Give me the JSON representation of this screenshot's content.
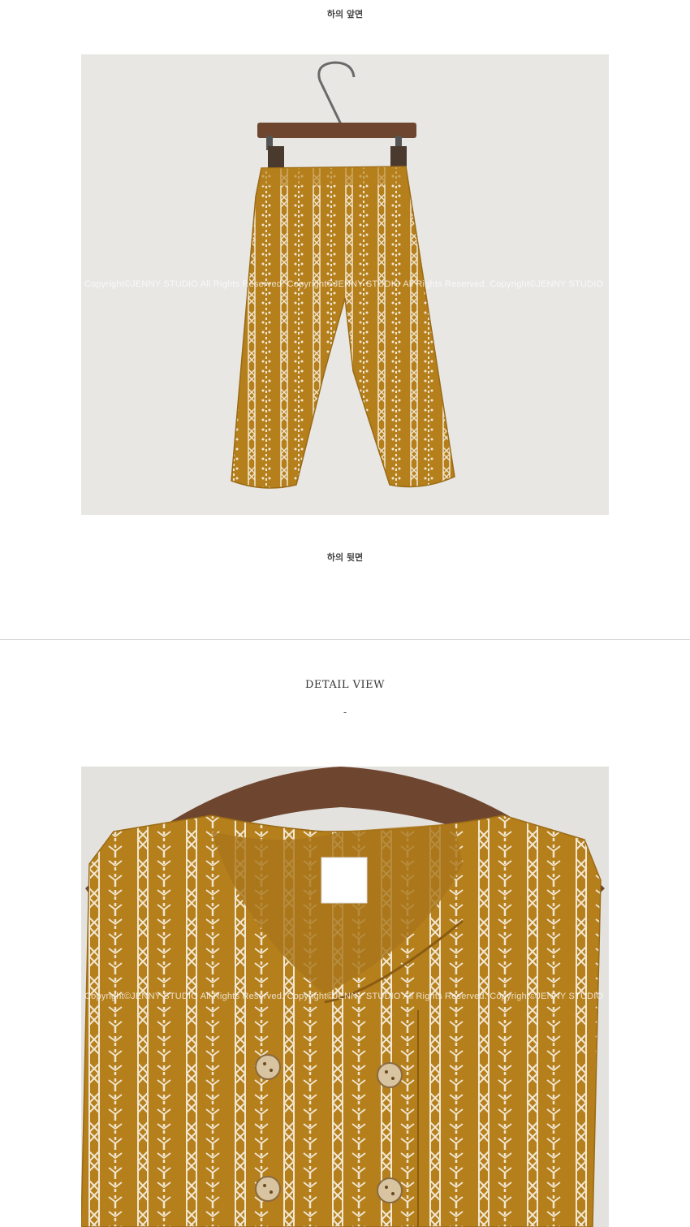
{
  "captions": {
    "front": "하의 앞면",
    "back": "하의 뒷면"
  },
  "watermark": "Copyright©JENNY STUDIO All Rights Reserved. Copyright©JENNY STUDIO All Rights Reserved. Copyright©JENNY STUDIO",
  "detail": {
    "title": "DETAIL VIEW",
    "dash": "-"
  },
  "colors": {
    "fabric": "#b57f1c",
    "background": "#e9e8e6",
    "hanger_wood": "#6e4630"
  }
}
